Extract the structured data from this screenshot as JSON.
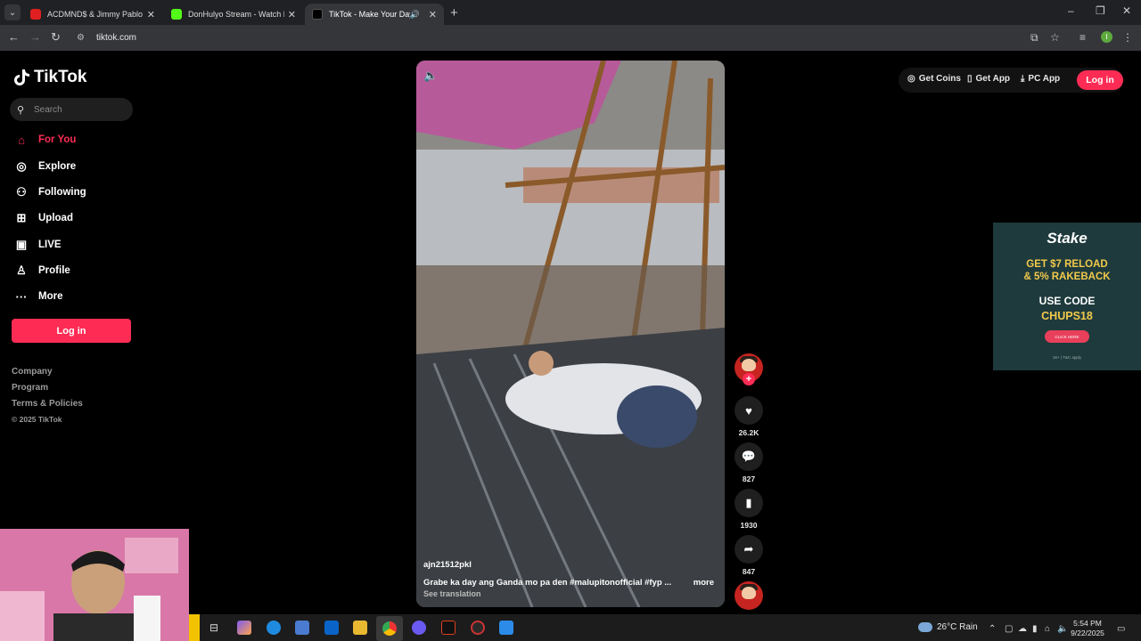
{
  "browser": {
    "tabs": [
      {
        "title": "ACDMND$ & Jimmy Pablo - IC$",
        "favicon_color": "#e02020"
      },
      {
        "title": "DonHulyo Stream - Watch Live",
        "favicon_color": "#53fc18"
      },
      {
        "title": "TikTok - Make Your Day",
        "favicon_color": "#000000",
        "active": true
      }
    ],
    "url": "tiktok.com",
    "profile_initial": "I"
  },
  "sidebar": {
    "logo": "TikTok",
    "search_placeholder": "Search",
    "nav": [
      {
        "label": "For You",
        "icon": "home-icon",
        "active": true
      },
      {
        "label": "Explore",
        "icon": "compass-icon"
      },
      {
        "label": "Following",
        "icon": "person-icon"
      },
      {
        "label": "Upload",
        "icon": "upload-icon"
      },
      {
        "label": "LIVE",
        "icon": "live-tv-icon"
      },
      {
        "label": "Profile",
        "icon": "profile-icon"
      },
      {
        "label": "More",
        "icon": "more-dots-icon"
      }
    ],
    "login_label": "Log in",
    "footer": {
      "company": "Company",
      "program": "Program",
      "terms": "Terms & Policies",
      "copyright": "© 2025 TikTok"
    }
  },
  "header": {
    "get_coins": "Get Coins",
    "get_app": "Get App",
    "pc_app": "PC App",
    "login": "Log in"
  },
  "video": {
    "username": "ajn21512pkl",
    "caption": "Grabe ka day ang Ganda mo pa den #malupitonofficial  #fyp  ...",
    "more": "more",
    "see_translation": "See translation"
  },
  "actions": {
    "likes": "26.2K",
    "comments": "827",
    "saves": "1930",
    "shares": "847"
  },
  "ad": {
    "brand": "Stake",
    "line1": "GET $7 RELOAD",
    "line2": "& 5% RAKEBACK",
    "line3": "USE CODE",
    "code": "CHUPS18",
    "cta": "CLICK HERE",
    "fine": "18+ | T&C apply"
  },
  "taskbar": {
    "weather": "26°C  Rain",
    "time": "5:54 PM",
    "date": "9/22/2025"
  },
  "colors": {
    "accent": "#fe2c55",
    "bg": "#000000",
    "ad_yellow": "#f2c94c"
  }
}
